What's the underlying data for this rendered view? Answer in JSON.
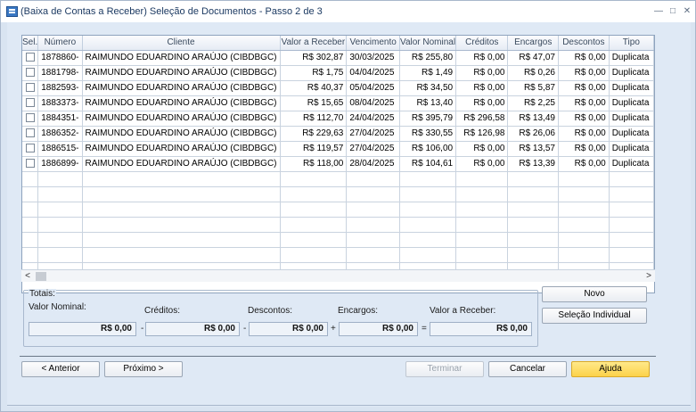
{
  "window": {
    "title": "(Baixa de Contas a Receber) Seleção de Documentos - Passo 2 de 3",
    "controls": [
      "minimize",
      "restore",
      "close"
    ]
  },
  "grid": {
    "columns": [
      "Sel.",
      "Número",
      "Cliente",
      "Valor a Receber",
      "Vencimento",
      "Valor Nominal",
      "Créditos",
      "Encargos",
      "Descontos",
      "Tipo"
    ],
    "rows": [
      {
        "numero": "1878860-",
        "cliente": "RAIMUNDO EDUARDINO ARAÚJO (CIBDBGC)",
        "valor_receber": "R$ 302,87",
        "vencimento": "30/03/2025",
        "valor_nominal": "R$ 255,80",
        "creditos": "R$ 0,00",
        "encargos": "R$ 47,07",
        "descontos": "R$ 0,00",
        "tipo": "Duplicata"
      },
      {
        "numero": "1881798-",
        "cliente": "RAIMUNDO EDUARDINO ARAÚJO (CIBDBGC)",
        "valor_receber": "R$ 1,75",
        "vencimento": "04/04/2025",
        "valor_nominal": "R$ 1,49",
        "creditos": "R$ 0,00",
        "encargos": "R$ 0,26",
        "descontos": "R$ 0,00",
        "tipo": "Duplicata"
      },
      {
        "numero": "1882593-",
        "cliente": "RAIMUNDO EDUARDINO ARAÚJO (CIBDBGC)",
        "valor_receber": "R$ 40,37",
        "vencimento": "05/04/2025",
        "valor_nominal": "R$ 34,50",
        "creditos": "R$ 0,00",
        "encargos": "R$ 5,87",
        "descontos": "R$ 0,00",
        "tipo": "Duplicata"
      },
      {
        "numero": "1883373-",
        "cliente": "RAIMUNDO EDUARDINO ARAÚJO (CIBDBGC)",
        "valor_receber": "R$ 15,65",
        "vencimento": "08/04/2025",
        "valor_nominal": "R$ 13,40",
        "creditos": "R$ 0,00",
        "encargos": "R$ 2,25",
        "descontos": "R$ 0,00",
        "tipo": "Duplicata"
      },
      {
        "numero": "1884351-",
        "cliente": "RAIMUNDO EDUARDINO ARAÚJO (CIBDBGC)",
        "valor_receber": "R$ 112,70",
        "vencimento": "24/04/2025",
        "valor_nominal": "R$ 395,79",
        "creditos": "R$ 296,58",
        "encargos": "R$ 13,49",
        "descontos": "R$ 0,00",
        "tipo": "Duplicata"
      },
      {
        "numero": "1886352-",
        "cliente": "RAIMUNDO EDUARDINO ARAÚJO (CIBDBGC)",
        "valor_receber": "R$ 229,63",
        "vencimento": "27/04/2025",
        "valor_nominal": "R$ 330,55",
        "creditos": "R$ 126,98",
        "encargos": "R$ 26,06",
        "descontos": "R$ 0,00",
        "tipo": "Duplicata"
      },
      {
        "numero": "1886515-",
        "cliente": "RAIMUNDO EDUARDINO ARAÚJO (CIBDBGC)",
        "valor_receber": "R$ 119,57",
        "vencimento": "27/04/2025",
        "valor_nominal": "R$ 106,00",
        "creditos": "R$ 0,00",
        "encargos": "R$ 13,57",
        "descontos": "R$ 0,00",
        "tipo": "Duplicata"
      },
      {
        "numero": "1886899-",
        "cliente": "RAIMUNDO EDUARDINO ARAÚJO (CIBDBGC)",
        "valor_receber": "R$ 118,00",
        "vencimento": "28/04/2025",
        "valor_nominal": "R$ 104,61",
        "creditos": "R$ 0,00",
        "encargos": "R$ 13,39",
        "descontos": "R$ 0,00",
        "tipo": "Duplicata"
      }
    ],
    "scroll_left": "<",
    "scroll_right": ">"
  },
  "totais": {
    "title": "Totais:",
    "valor_nominal_label": "Valor Nominal:",
    "creditos_label": "Créditos:",
    "descontos_label": "Descontos:",
    "encargos_label": "Encargos:",
    "valor_receber_label": "Valor a Receber:",
    "valor_nominal": "R$ 0,00",
    "creditos": "R$ 0,00",
    "descontos": "R$ 0,00",
    "encargos": "R$ 0,00",
    "valor_receber": "R$ 0,00",
    "op_minus1": "-",
    "op_minus2": "-",
    "op_plus": "+",
    "op_equals": "="
  },
  "side_buttons": {
    "novo": "Novo",
    "selecao_individual": "Seleção Individual"
  },
  "footer": {
    "anterior": "< Anterior",
    "proximo": "Próximo >",
    "terminar": "Terminar",
    "cancelar": "Cancelar",
    "ajuda": "Ajuda"
  }
}
